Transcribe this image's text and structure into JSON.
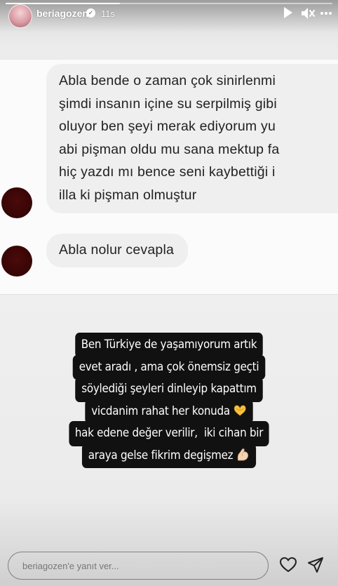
{
  "story": {
    "progress": 0.35
  },
  "header": {
    "username": "beriagozen",
    "verified_icon": "verified-badge-icon",
    "time": "11s",
    "icons": [
      "play-icon",
      "mute-icon",
      "more-icon"
    ]
  },
  "dm": {
    "bubble1_lines": [
      "Abla bende o zaman çok sinirlenmi",
      "şimdi insanın içine su serpilmiş gibi",
      "oluyor ben şeyi merak ediyorum yu",
      "abi pişman oldu mu sana mektup fa",
      "hiç yazdı mı bence seni kaybettiği i",
      "illa ki pişman olmuştur"
    ],
    "bubble2": "Abla nolur cevapla"
  },
  "overlay": {
    "lines": [
      "Ben Türkiye de yaşamıyorum artık",
      "evet aradı , ama çok önemsiz geçti",
      "söylediği şeyleri dinleyip kapattım",
      "vicdanim rahat her konuda",
      "hak edene değer verilir,  iki cihan bir",
      "araya gelse fikrim degişmez"
    ],
    "emojis": [
      "heart-hands-icon",
      "flexed-biceps-icon"
    ]
  },
  "reply": {
    "placeholder": "beriagozen'e yanıt ver..."
  },
  "footer_icons": [
    "heart-icon",
    "send-icon"
  ],
  "colors": {
    "overlay_bg": "#111111",
    "bubble_bg": "#efefef",
    "dm_avatar": "#3a0505"
  }
}
